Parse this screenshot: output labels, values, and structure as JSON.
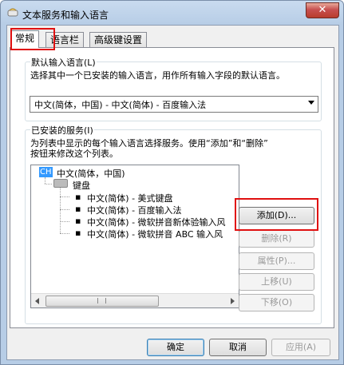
{
  "window": {
    "title": "文本服务和输入语言"
  },
  "tabs": [
    {
      "label": "常规"
    },
    {
      "label": "语言栏"
    },
    {
      "label": "高级键设置"
    }
  ],
  "default_language": {
    "label": "默认输入语言(L)",
    "description": "选择其中一个已安装的输入语言，用作所有输入字段的默认语言。",
    "selected": "中文(简体，中国) - 中文(简体) - 百度输入法"
  },
  "installed_services": {
    "label": "已安装的服务(I)",
    "description1": "为列表中显示的每个输入语言选择服务。使用“添加”和“删除”",
    "description2": "按钮来修改这个列表。",
    "language_badge": "CH",
    "language": "中文(简体，中国)",
    "category": "键盘",
    "items": [
      "中文(简体) - 美式键盘",
      "中文(简体) - 百度输入法",
      "中文(简体) - 微软拼音新体验输入风",
      "中文(简体) - 微软拼音 ABC 输入风"
    ]
  },
  "side_buttons": {
    "add": "添加(D)...",
    "remove": "删除(R)",
    "properties": "属性(P)...",
    "move_up": "上移(U)",
    "move_down": "下移(O)"
  },
  "footer": {
    "ok": "确定",
    "cancel": "取消",
    "apply": "应用(A)"
  },
  "colors": {
    "highlight": "#e01010",
    "accent": "#3399ff"
  }
}
